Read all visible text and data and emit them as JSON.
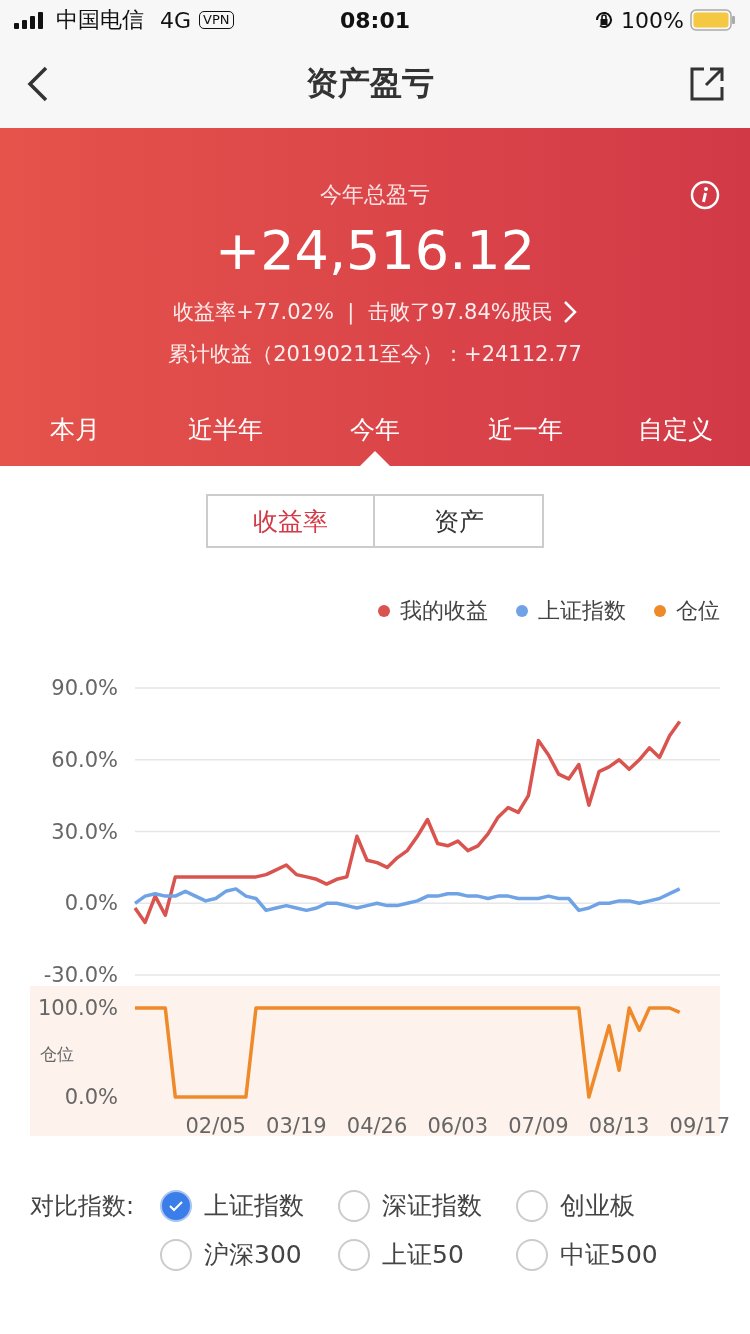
{
  "status_bar": {
    "carrier": "中国电信",
    "network": "4G",
    "vpn": "VPN",
    "time": "08:01",
    "battery": "100%"
  },
  "nav": {
    "title": "资产盈亏"
  },
  "summary": {
    "label": "今年总盈亏",
    "amount": "+24,516.12",
    "rate_line": "收益率+77.02%  |  击败了97.84%股民",
    "cumulative": "累计收益（20190211至今）：+24112.77"
  },
  "period_tabs": [
    {
      "label": "本月",
      "selected": false
    },
    {
      "label": "近半年",
      "selected": false
    },
    {
      "label": "今年",
      "selected": true
    },
    {
      "label": "近一年",
      "selected": false
    },
    {
      "label": "自定义",
      "selected": false
    }
  ],
  "segments": [
    {
      "label": "收益率",
      "selected": true
    },
    {
      "label": "资产",
      "selected": false
    }
  ],
  "legend": [
    {
      "label": "我的收益",
      "color": "#d9534f"
    },
    {
      "label": "上证指数",
      "color": "#6fa3e6"
    },
    {
      "label": "仓位",
      "color": "#ef8a2a"
    }
  ],
  "return_chart": {
    "chart_data": {
      "type": "line",
      "grid": true,
      "ylim": [
        -30,
        90
      ],
      "yticks": [
        {
          "value": 90,
          "label": "90.0%"
        },
        {
          "value": 60,
          "label": "60.0%"
        },
        {
          "value": 30,
          "label": "30.0%"
        },
        {
          "value": 0,
          "label": "0.0%"
        },
        {
          "value": -30,
          "label": "-30.0%"
        }
      ],
      "series": [
        {
          "color": "#d9534f",
          "values": [
            -2,
            -8,
            3,
            -5,
            11,
            11,
            11,
            11,
            11,
            11,
            11,
            11,
            11,
            12,
            14,
            16,
            12,
            11,
            10,
            8,
            10,
            11,
            28,
            18,
            17,
            15,
            19,
            22,
            28,
            35,
            25,
            24,
            26,
            22,
            24,
            29,
            36,
            40,
            38,
            45,
            68,
            62,
            54,
            52,
            58,
            41,
            55,
            57,
            60,
            56,
            60,
            65,
            61,
            70,
            76
          ]
        },
        {
          "color": "#6fa3e6",
          "values": [
            0,
            3,
            4,
            3,
            3,
            5,
            3,
            1,
            2,
            5,
            6,
            3,
            2,
            -3,
            -2,
            -1,
            -2,
            -3,
            -2,
            0,
            0,
            -1,
            -2,
            -1,
            0,
            -1,
            -1,
            0,
            1,
            3,
            3,
            4,
            4,
            3,
            3,
            2,
            3,
            3,
            2,
            2,
            2,
            3,
            2,
            2,
            -3,
            -2,
            0,
            0,
            1,
            1,
            0,
            1,
            2,
            4,
            6
          ]
        }
      ]
    }
  },
  "position_chart": {
    "chart_data": {
      "type": "line",
      "ylabel": "仓位",
      "ylim": [
        0,
        100
      ],
      "yticks": [
        {
          "value": 100,
          "label": "100.0%"
        },
        {
          "value": 0,
          "label": "0.0%"
        }
      ],
      "categories": [
        null,
        null,
        null,
        null,
        null,
        null,
        null,
        null,
        "02/05",
        null,
        null,
        null,
        null,
        null,
        null,
        null,
        "03/19",
        null,
        null,
        null,
        null,
        null,
        null,
        null,
        "04/26",
        null,
        null,
        null,
        null,
        null,
        null,
        null,
        "06/03",
        null,
        null,
        null,
        null,
        null,
        null,
        null,
        "07/09",
        null,
        null,
        null,
        null,
        null,
        null,
        null,
        "08/13",
        null,
        null,
        null,
        null,
        null,
        null,
        null,
        "09/17"
      ],
      "series": [
        {
          "color": "#ef8a2a",
          "values": [
            100,
            100,
            100,
            100,
            0,
            0,
            0,
            0,
            0,
            0,
            0,
            0,
            100,
            100,
            100,
            100,
            100,
            100,
            100,
            100,
            100,
            100,
            100,
            100,
            100,
            100,
            100,
            100,
            100,
            100,
            100,
            100,
            100,
            100,
            100,
            100,
            100,
            100,
            100,
            100,
            100,
            100,
            100,
            100,
            100,
            0,
            40,
            80,
            30,
            100,
            75,
            100,
            100,
            100,
            95,
            null,
            null
          ]
        }
      ]
    }
  },
  "compare": {
    "label": "对比指数:",
    "options": [
      {
        "label": "上证指数",
        "selected": true
      },
      {
        "label": "深证指数",
        "selected": false
      },
      {
        "label": "创业板",
        "selected": false
      },
      {
        "label": "沪深300",
        "selected": false
      },
      {
        "label": "上证50",
        "selected": false
      },
      {
        "label": "中证500",
        "selected": false
      }
    ]
  }
}
